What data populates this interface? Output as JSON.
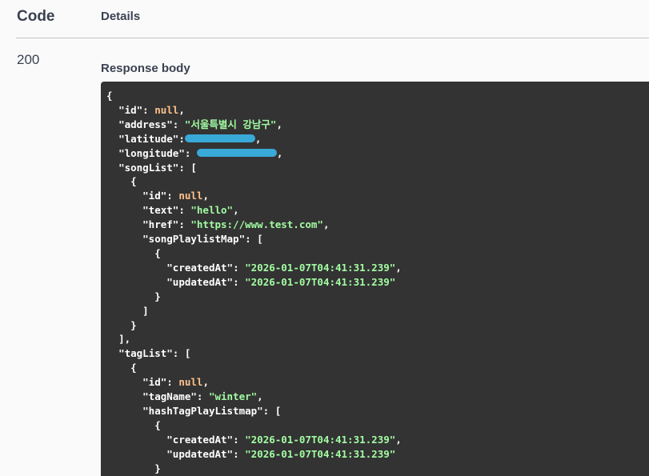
{
  "table_header": {
    "code": "Code",
    "details": "Details"
  },
  "response": {
    "status_code": "200",
    "body_label": "Response body"
  },
  "json": {
    "id_key": "\"id\"",
    "null": "null",
    "address_key": "\"address\"",
    "address_value": "\"서울특별시 강남구\"",
    "latitude_key": "\"latitude\"",
    "longitude_key": "\"longitude\"",
    "songList_key": "\"songList\"",
    "text_key": "\"text\"",
    "text_value": "\"hello\"",
    "href_key": "\"href\"",
    "href_value": "\"https://www.test.com\"",
    "songPlaylistMap_key": "\"songPlaylistMap\"",
    "createdAt_key": "\"createdAt\"",
    "updatedAt_key": "\"updatedAt\"",
    "timestamp": "\"2026-01-07T04:41:31.239\"",
    "tagList_key": "\"tagList\"",
    "tagName_key": "\"tagName\"",
    "tagName_value": "\"winter\"",
    "hashTagPlayListmap_key": "\"hashTagPlayListmap\""
  },
  "colors": {
    "code_background": "#333333",
    "string": "#a2fca2",
    "null": "#fcc28c",
    "redaction": "#39a9d8"
  }
}
